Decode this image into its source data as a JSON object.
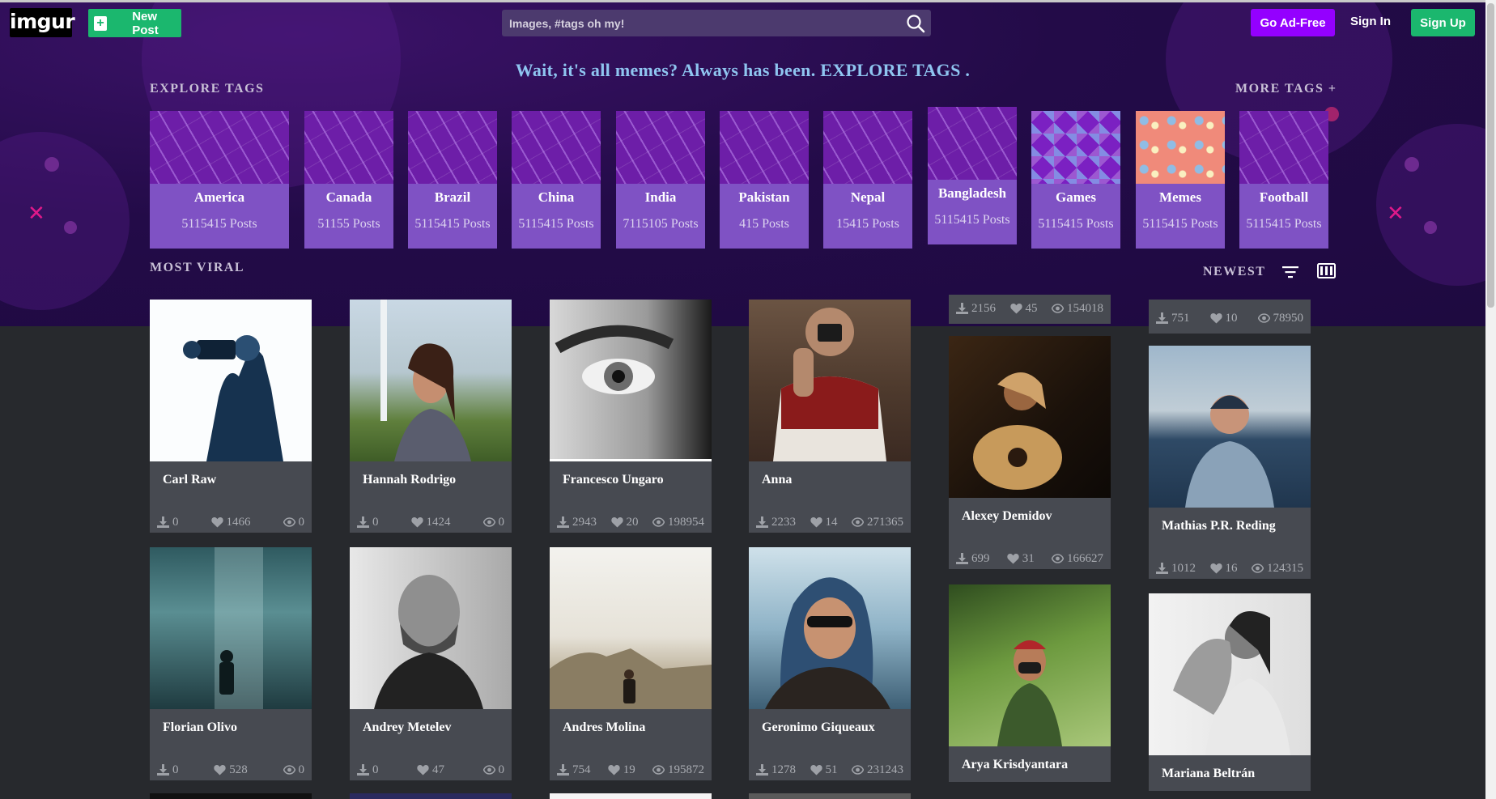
{
  "header": {
    "logo": "imgur",
    "new_post": "New Post",
    "search_placeholder": "Images, #tags oh my!",
    "go_ad_free": "Go Ad-Free",
    "sign_in": "Sign In",
    "sign_up": "Sign Up"
  },
  "hero": {
    "tagline": "Wait, it's all memes? Always has been. EXPLORE TAGS .",
    "explore_tags": "EXPLORE TAGS",
    "more_tags": "MORE TAGS +",
    "most_viral": "MOST VIRAL",
    "newest": "NEWEST"
  },
  "tags": [
    {
      "name": "America",
      "posts": "5115415 Posts",
      "art": "pattern"
    },
    {
      "name": "Canada",
      "posts": "51155 Posts",
      "art": "pattern"
    },
    {
      "name": "Brazil",
      "posts": "5115415 Posts",
      "art": "pattern"
    },
    {
      "name": "China",
      "posts": "5115415 Posts",
      "art": "pattern"
    },
    {
      "name": "India",
      "posts": "7115105 Posts",
      "art": "pattern"
    },
    {
      "name": "Pakistan",
      "posts": "415 Posts",
      "art": "pattern"
    },
    {
      "name": "Nepal",
      "posts": "15415 Posts",
      "art": "pattern"
    },
    {
      "name": "Bangladesh",
      "posts": "5115415 Posts",
      "art": "pattern"
    },
    {
      "name": "Games",
      "posts": "5115415 Posts",
      "art": "gems"
    },
    {
      "name": "Memes",
      "posts": "5115415 Posts",
      "art": "memes"
    },
    {
      "name": "Football",
      "posts": "5115415 Posts",
      "art": "pattern"
    }
  ],
  "posts": [
    {
      "name": "Carl Raw",
      "downloads": "0",
      "likes": "1466",
      "views": "0"
    },
    {
      "name": "Hannah Rodrigo",
      "downloads": "0",
      "likes": "1424",
      "views": "0"
    },
    {
      "name": "Francesco Ungaro",
      "downloads": "2943",
      "likes": "20",
      "views": "198954"
    },
    {
      "name": "Anna",
      "downloads": "2233",
      "likes": "14",
      "views": "271365"
    },
    {
      "name": "Alexey Demidov",
      "downloads": "699",
      "likes": "31",
      "views": "166627"
    },
    {
      "name": "Mathias P.R. Reding",
      "downloads": "1012",
      "likes": "16",
      "views": "124315"
    },
    {
      "name": "Florian Olivo",
      "downloads": "0",
      "likes": "528",
      "views": "0"
    },
    {
      "name": "Andrey Metelev",
      "downloads": "0",
      "likes": "47",
      "views": "0"
    },
    {
      "name": "Andres Molina",
      "downloads": "754",
      "likes": "19",
      "views": "195872"
    },
    {
      "name": "Geronimo Giqueaux",
      "downloads": "1278",
      "likes": "51",
      "views": "231243"
    },
    {
      "name": "Arya Krisdyantara",
      "downloads": "",
      "likes": "",
      "views": ""
    },
    {
      "name": "Mariana Beltrán",
      "downloads": "",
      "likes": "",
      "views": ""
    }
  ],
  "partial_posts": [
    {
      "downloads": "2156",
      "likes": "45",
      "views": "154018"
    },
    {
      "downloads": "751",
      "likes": "10",
      "views": "78950"
    }
  ],
  "colors": {
    "hero_bg": "#230b48",
    "accent_green": "#1bb76e",
    "accent_purple": "#9400ff",
    "tag_card": "#7f52c4",
    "card_bg": "#474a51",
    "page_bg": "#27292d"
  }
}
